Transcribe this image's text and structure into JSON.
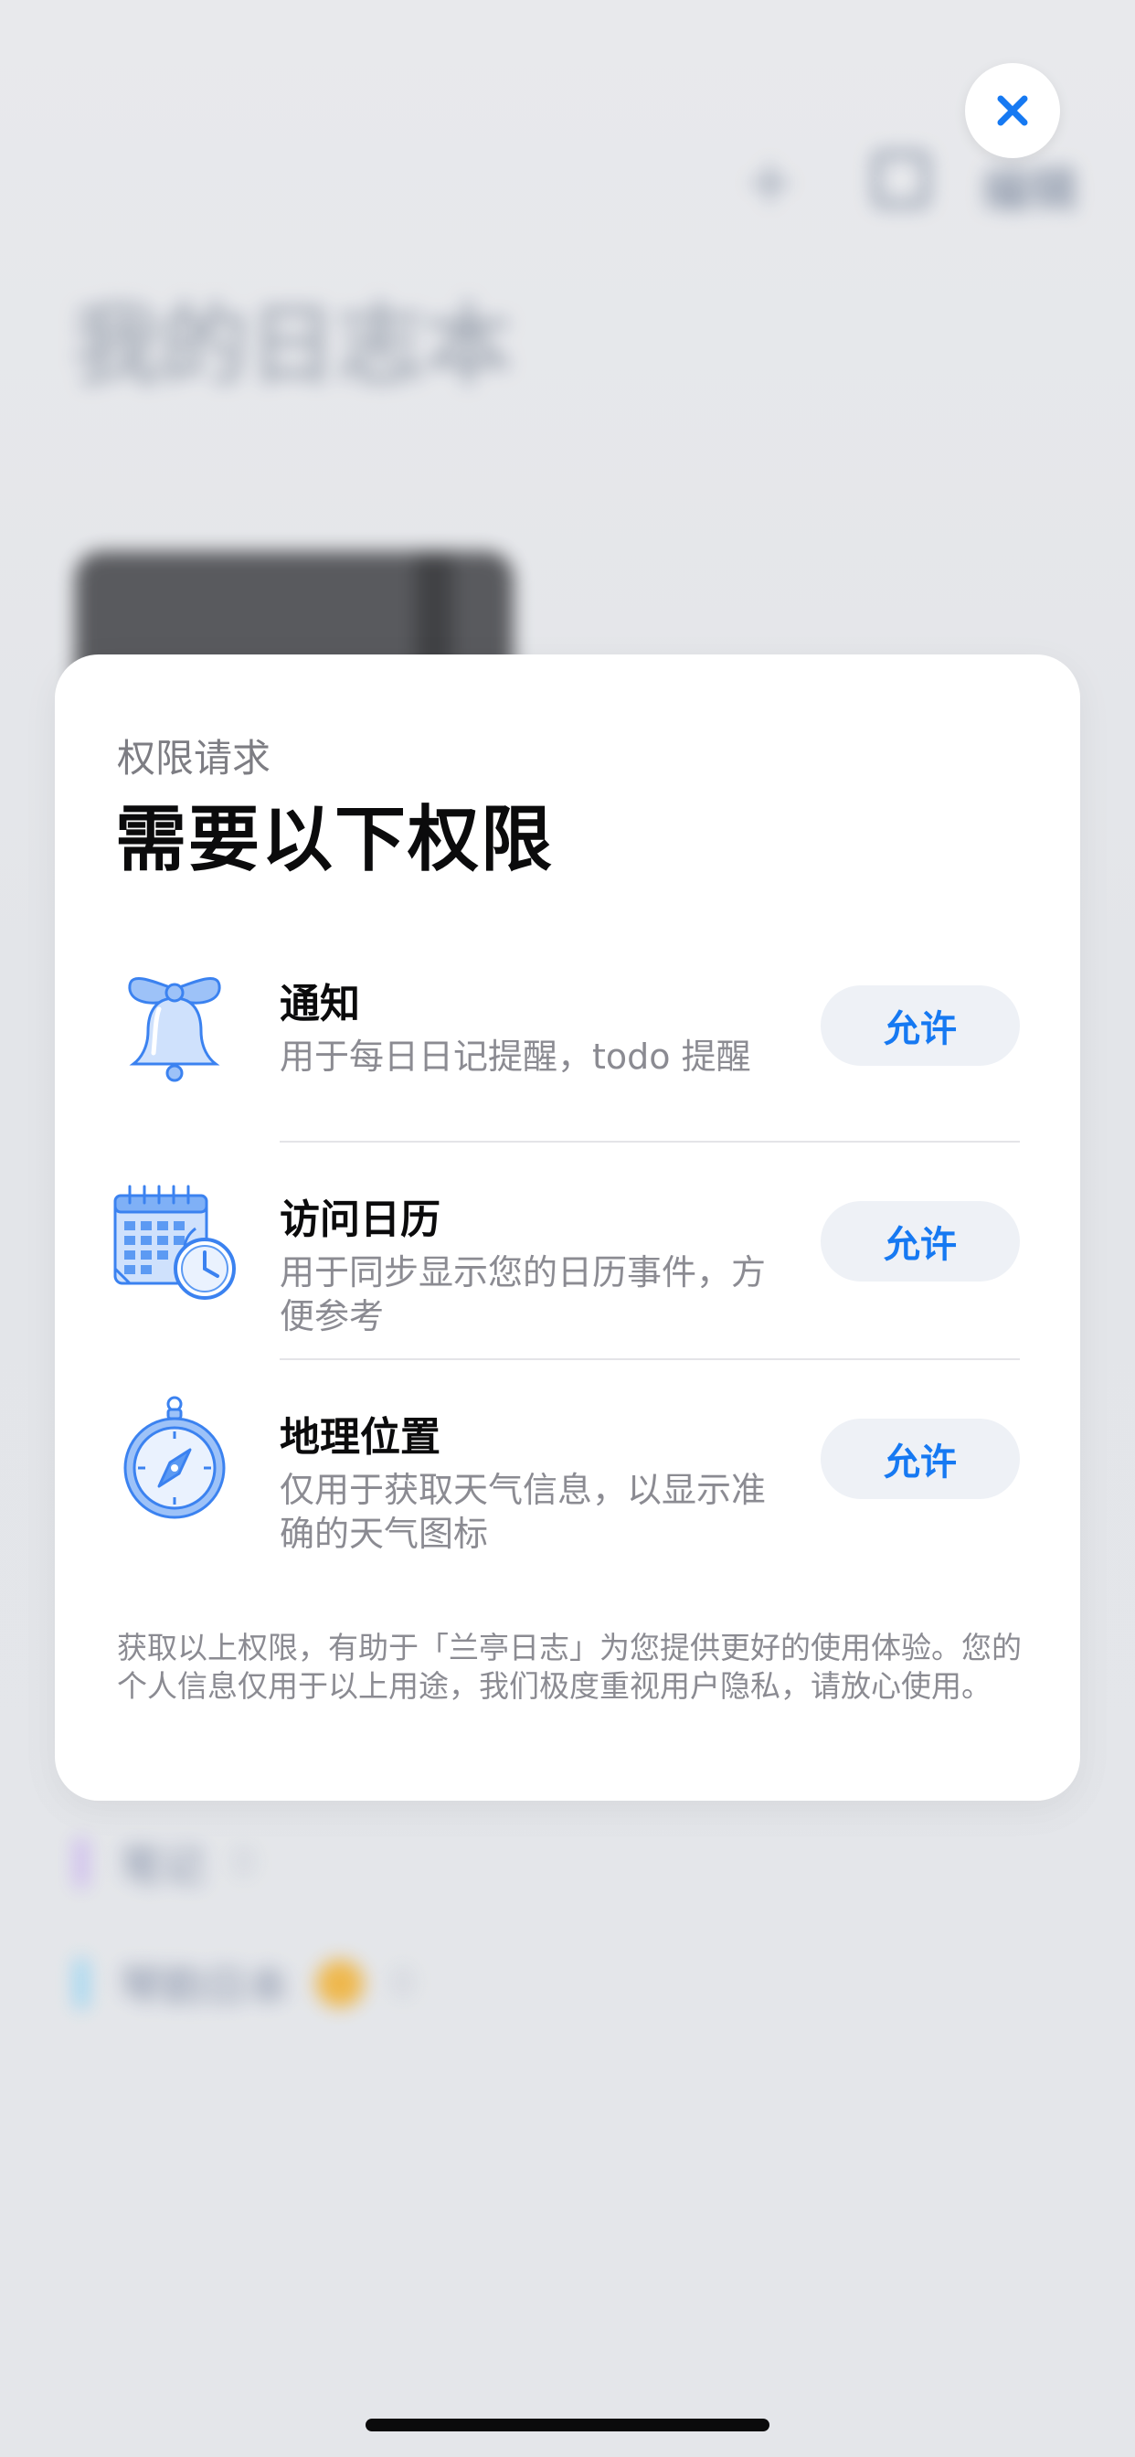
{
  "background": {
    "title": "我的日志本",
    "edit_label": "编辑",
    "rows": [
      {
        "label": "笔记",
        "count": "0",
        "color": "#b99be8"
      },
      {
        "label": "琴韵日本",
        "count": "0",
        "color": "#73c7f2"
      }
    ]
  },
  "close_icon": "close-icon",
  "dialog": {
    "eyebrow": "权限请求",
    "title": "需要以下权限",
    "permissions": [
      {
        "icon": "bell-icon",
        "title": "通知",
        "desc": "用于每日日记提醒，todo 提醒",
        "button": "允许"
      },
      {
        "icon": "calendar-clock-icon",
        "title": "访问日历",
        "desc": "用于同步显示您的日历事件，方便参考",
        "button": "允许"
      },
      {
        "icon": "compass-icon",
        "title": "地理位置",
        "desc": "仅用于获取天气信息，以显示准确的天气图标",
        "button": "允许"
      }
    ],
    "footer": "获取以上权限，有助于「兰亭日志」为您提供更好的使用体验。您的个人信息仅用于以上用途，我们极度重视用户隐私，请放心使用。"
  },
  "colors": {
    "accent": "#1679F2",
    "icon_blue": "#4A8EF0",
    "icon_fill": "#9DC2F8"
  }
}
